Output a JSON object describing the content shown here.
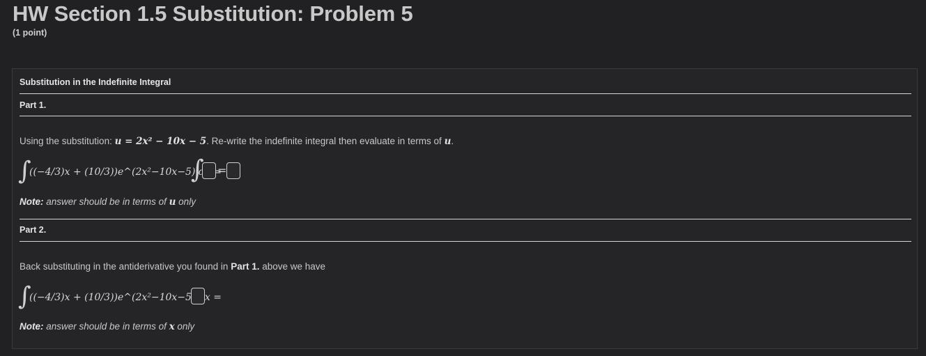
{
  "page": {
    "title": "HW Section 1.5 Substitution: Problem 5",
    "points": "(1 point)"
  },
  "problem": {
    "heading": "Substitution in the Indefinite Integral",
    "part1": {
      "label": "Part 1.",
      "intro_before": "Using the substitution: ",
      "substitution": "u = 2x² − 10x − 5",
      "intro_after": ". Re-write the indefinite integral then evaluate in terms of ",
      "intro_var": "u",
      "intro_end": ".",
      "integrand": "((−4/3)x + (10/3))e^(2x²−10x−5) dx =",
      "note_label": "Note:",
      "note_text": " answer should be in terms of ",
      "note_var": "u",
      "note_end": " only"
    },
    "part2": {
      "label": "Part 2.",
      "intro_before": "Back substituting in the antiderivative you found in ",
      "intro_bold": "Part 1.",
      "intro_after": " above we have",
      "integrand": "((−4/3)x + (10/3))e^(2x²−10x−5) dx =",
      "note_label": "Note:",
      "note_text": " answer should be in terms of ",
      "note_var": "x",
      "note_end": " only"
    }
  }
}
